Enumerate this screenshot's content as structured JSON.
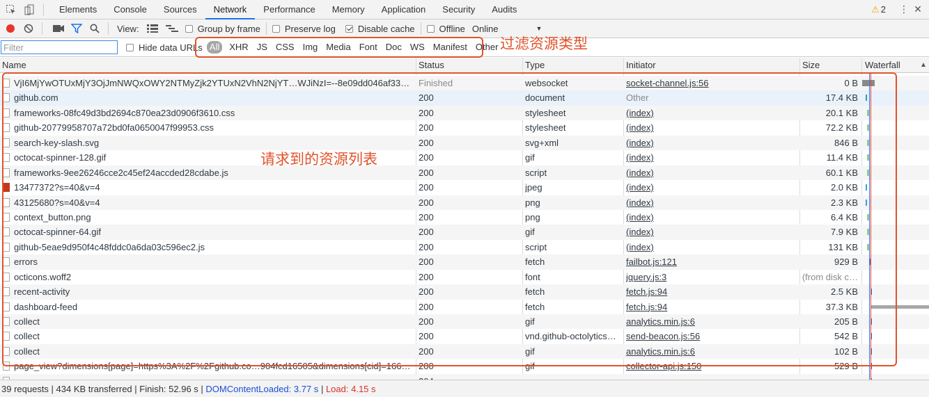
{
  "tabs": [
    "Elements",
    "Console",
    "Sources",
    "Network",
    "Performance",
    "Memory",
    "Application",
    "Security",
    "Audits"
  ],
  "active_tab": "Network",
  "warning_count": "2",
  "toolbar": {
    "view_label": "View:",
    "group_by_frame": "Group by frame",
    "preserve_log": "Preserve log",
    "disable_cache": "Disable cache",
    "offline": "Offline",
    "throttle": "Online"
  },
  "filter": {
    "placeholder": "Filter",
    "hide_data_urls": "Hide data URLs",
    "types": [
      "All",
      "XHR",
      "JS",
      "CSS",
      "Img",
      "Media",
      "Font",
      "Doc",
      "WS",
      "Manifest",
      "Other"
    ]
  },
  "columns": [
    "Name",
    "Status",
    "Type",
    "Initiator",
    "Size",
    "Waterfall"
  ],
  "sort_indicator": "▲",
  "rows": [
    {
      "name": "VjI6MjYwOTUxMjY3OjJmNWQxOWY2NTMyZjk2YTUxN2VhN2NjYT…WJiNzI=--8e09dd046af333b7af…",
      "status": "Finished",
      "type": "websocket",
      "initiator": "socket-channel.js:56",
      "size": "0 B"
    },
    {
      "name": "github.com",
      "status": "200",
      "type": "document",
      "initiator": "Other",
      "size": "17.4 KB"
    },
    {
      "name": "frameworks-08fc49d3bd2694c870ea23d0906f3610.css",
      "status": "200",
      "type": "stylesheet",
      "initiator": "(index)",
      "size": "20.1 KB"
    },
    {
      "name": "github-20779958707a72bd0fa0650047f99953.css",
      "status": "200",
      "type": "stylesheet",
      "initiator": "(index)",
      "size": "72.2 KB"
    },
    {
      "name": "search-key-slash.svg",
      "status": "200",
      "type": "svg+xml",
      "initiator": "(index)",
      "size": "846 B"
    },
    {
      "name": "octocat-spinner-128.gif",
      "status": "200",
      "type": "gif",
      "initiator": "(index)",
      "size": "11.4 KB"
    },
    {
      "name": "frameworks-9ee26246cce2c45ef24accded28cdabe.js",
      "status": "200",
      "type": "script",
      "initiator": "(index)",
      "size": "60.1 KB"
    },
    {
      "name": "13477372?s=40&v=4",
      "status": "200",
      "type": "jpeg",
      "initiator": "(index)",
      "size": "2.0 KB"
    },
    {
      "name": "43125680?s=40&v=4",
      "status": "200",
      "type": "png",
      "initiator": "(index)",
      "size": "2.3 KB"
    },
    {
      "name": "context_button.png",
      "status": "200",
      "type": "png",
      "initiator": "(index)",
      "size": "6.4 KB"
    },
    {
      "name": "octocat-spinner-64.gif",
      "status": "200",
      "type": "gif",
      "initiator": "(index)",
      "size": "7.9 KB"
    },
    {
      "name": "github-5eae9d950f4c48fddc0a6da03c596ec2.js",
      "status": "200",
      "type": "script",
      "initiator": "(index)",
      "size": "131 KB"
    },
    {
      "name": "errors",
      "status": "200",
      "type": "fetch",
      "initiator": "failbot.js:121",
      "size": "929 B"
    },
    {
      "name": "octicons.woff2",
      "status": "200",
      "type": "font",
      "initiator": "jquery.js:3",
      "size": "(from disk c…"
    },
    {
      "name": "recent-activity",
      "status": "200",
      "type": "fetch",
      "initiator": "fetch.js:94",
      "size": "2.5 KB"
    },
    {
      "name": "dashboard-feed",
      "status": "200",
      "type": "fetch",
      "initiator": "fetch.js:94",
      "size": "37.3 KB"
    },
    {
      "name": "collect",
      "status": "200",
      "type": "gif",
      "initiator": "analytics.min.js:6",
      "size": "205 B"
    },
    {
      "name": "collect",
      "status": "200",
      "type": "vnd.github-octolytics…",
      "initiator": "send-beacon.js:56",
      "size": "542 B"
    },
    {
      "name": "collect",
      "status": "200",
      "type": "gif",
      "initiator": "analytics.min.js:6",
      "size": "102 B"
    },
    {
      "name": "page_view?dimensions[page]=https%3A%2F%2Fgithub.co…904fcd16505&dimensions[cid]=166058…",
      "status": "200",
      "type": "gif",
      "initiator": "collector-api.js:150",
      "size": "529 B"
    },
    {
      "name": "",
      "status": "204",
      "type": "",
      "initiator": "",
      "size": ""
    }
  ],
  "statusbar": {
    "summary": "39 requests | 434 KB transferred | Finish: 52.96 s |",
    "dom_content_loaded": "DOMContentLoaded: 3.77 s",
    "sep": "|",
    "load": "Load: 4.15 s"
  },
  "annotations": {
    "filter_note": "过滤资源类型",
    "list_note": "请求到的资源列表"
  },
  "colors": {
    "accent": "#1a73e8",
    "annotation": "#e0532b",
    "dcl_line": "#1a4fd6",
    "load_line": "#d93025"
  }
}
